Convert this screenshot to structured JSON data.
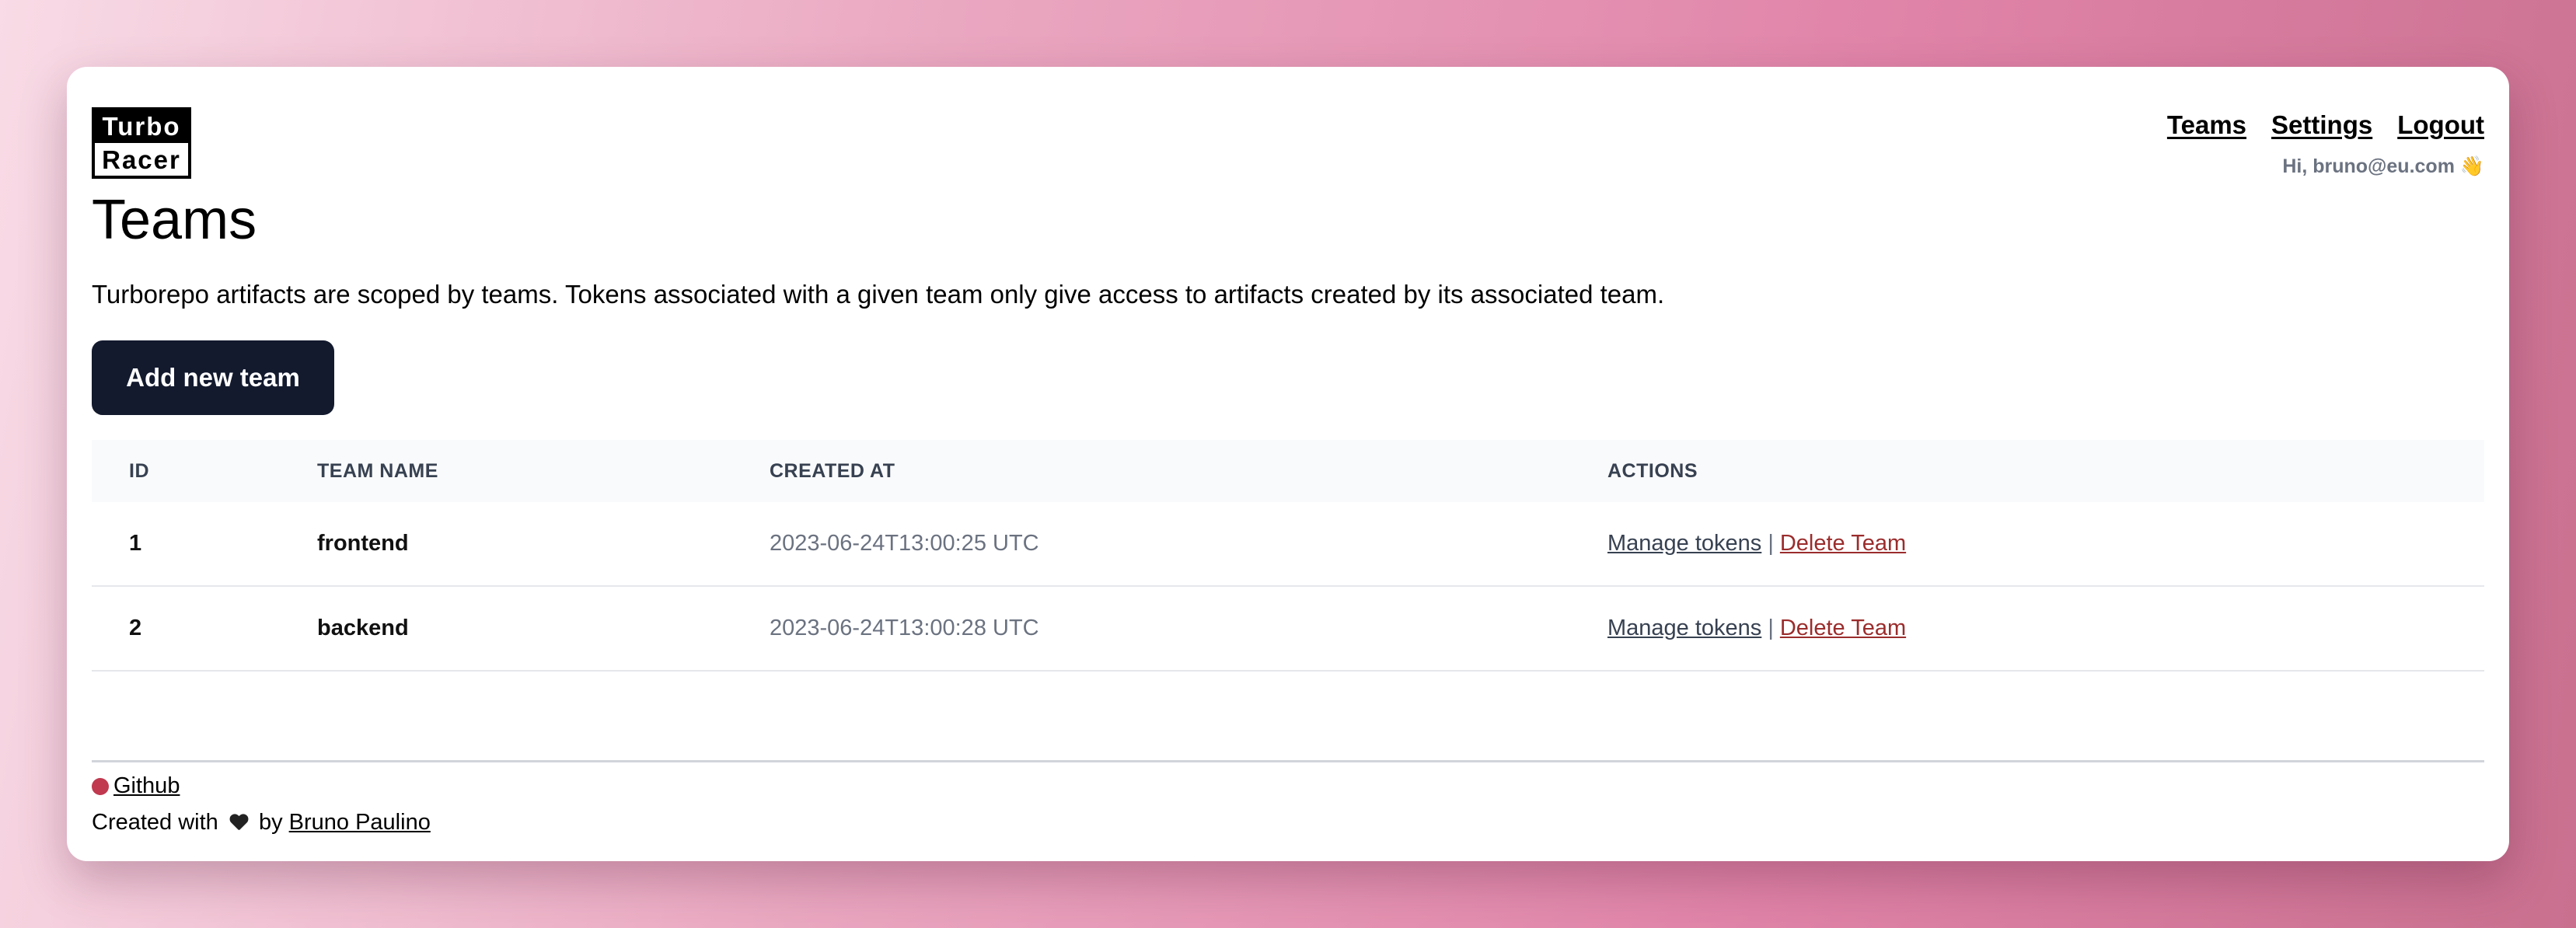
{
  "brand": {
    "logo_top": "Turbo",
    "logo_bottom": "Racer"
  },
  "nav": {
    "teams": "Teams",
    "settings": "Settings",
    "logout": "Logout"
  },
  "greeting": "Hi, bruno@eu.com 👋",
  "page": {
    "title": "Teams",
    "description": "Turborepo artifacts are scoped by teams. Tokens associated with a given team only give access to artifacts created by its associated team.",
    "add_button": "Add new team"
  },
  "table": {
    "headers": {
      "id": "ID",
      "name": "TEAM NAME",
      "created": "CREATED AT",
      "actions": "ACTIONS"
    },
    "rows": [
      {
        "id": "1",
        "name": "frontend",
        "created": "2023-06-24T13:00:25 UTC",
        "manage": "Manage tokens",
        "sep": "|",
        "delete": "Delete Team"
      },
      {
        "id": "2",
        "name": "backend",
        "created": "2023-06-24T13:00:28 UTC",
        "manage": "Manage tokens",
        "sep": "|",
        "delete": "Delete Team"
      }
    ]
  },
  "footer": {
    "github": "Github",
    "created_with": "Created with",
    "by": "by",
    "author": "Bruno Paulino"
  },
  "colors": {
    "primary_button": "#131a2e",
    "delete_link": "#9b2c2c",
    "background_gradient_end": "#e083a8"
  }
}
